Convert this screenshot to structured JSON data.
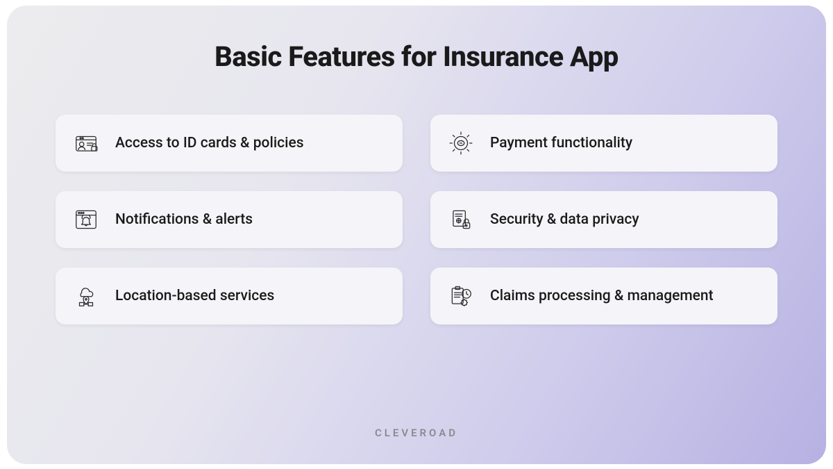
{
  "title": "Basic Features for Insurance App",
  "brand": "CLEVEROAD",
  "features": [
    {
      "label": "Access to ID cards & policies",
      "icon": "id-card-lock-icon"
    },
    {
      "label": "Payment functionality",
      "icon": "gear-money-icon"
    },
    {
      "label": "Notifications & alerts",
      "icon": "bell-window-icon"
    },
    {
      "label": "Security & data privacy",
      "icon": "document-lock-icon"
    },
    {
      "label": "Location-based services",
      "icon": "cloud-pin-icon"
    },
    {
      "label": "Claims processing & management",
      "icon": "clipboard-clock-icon"
    }
  ]
}
